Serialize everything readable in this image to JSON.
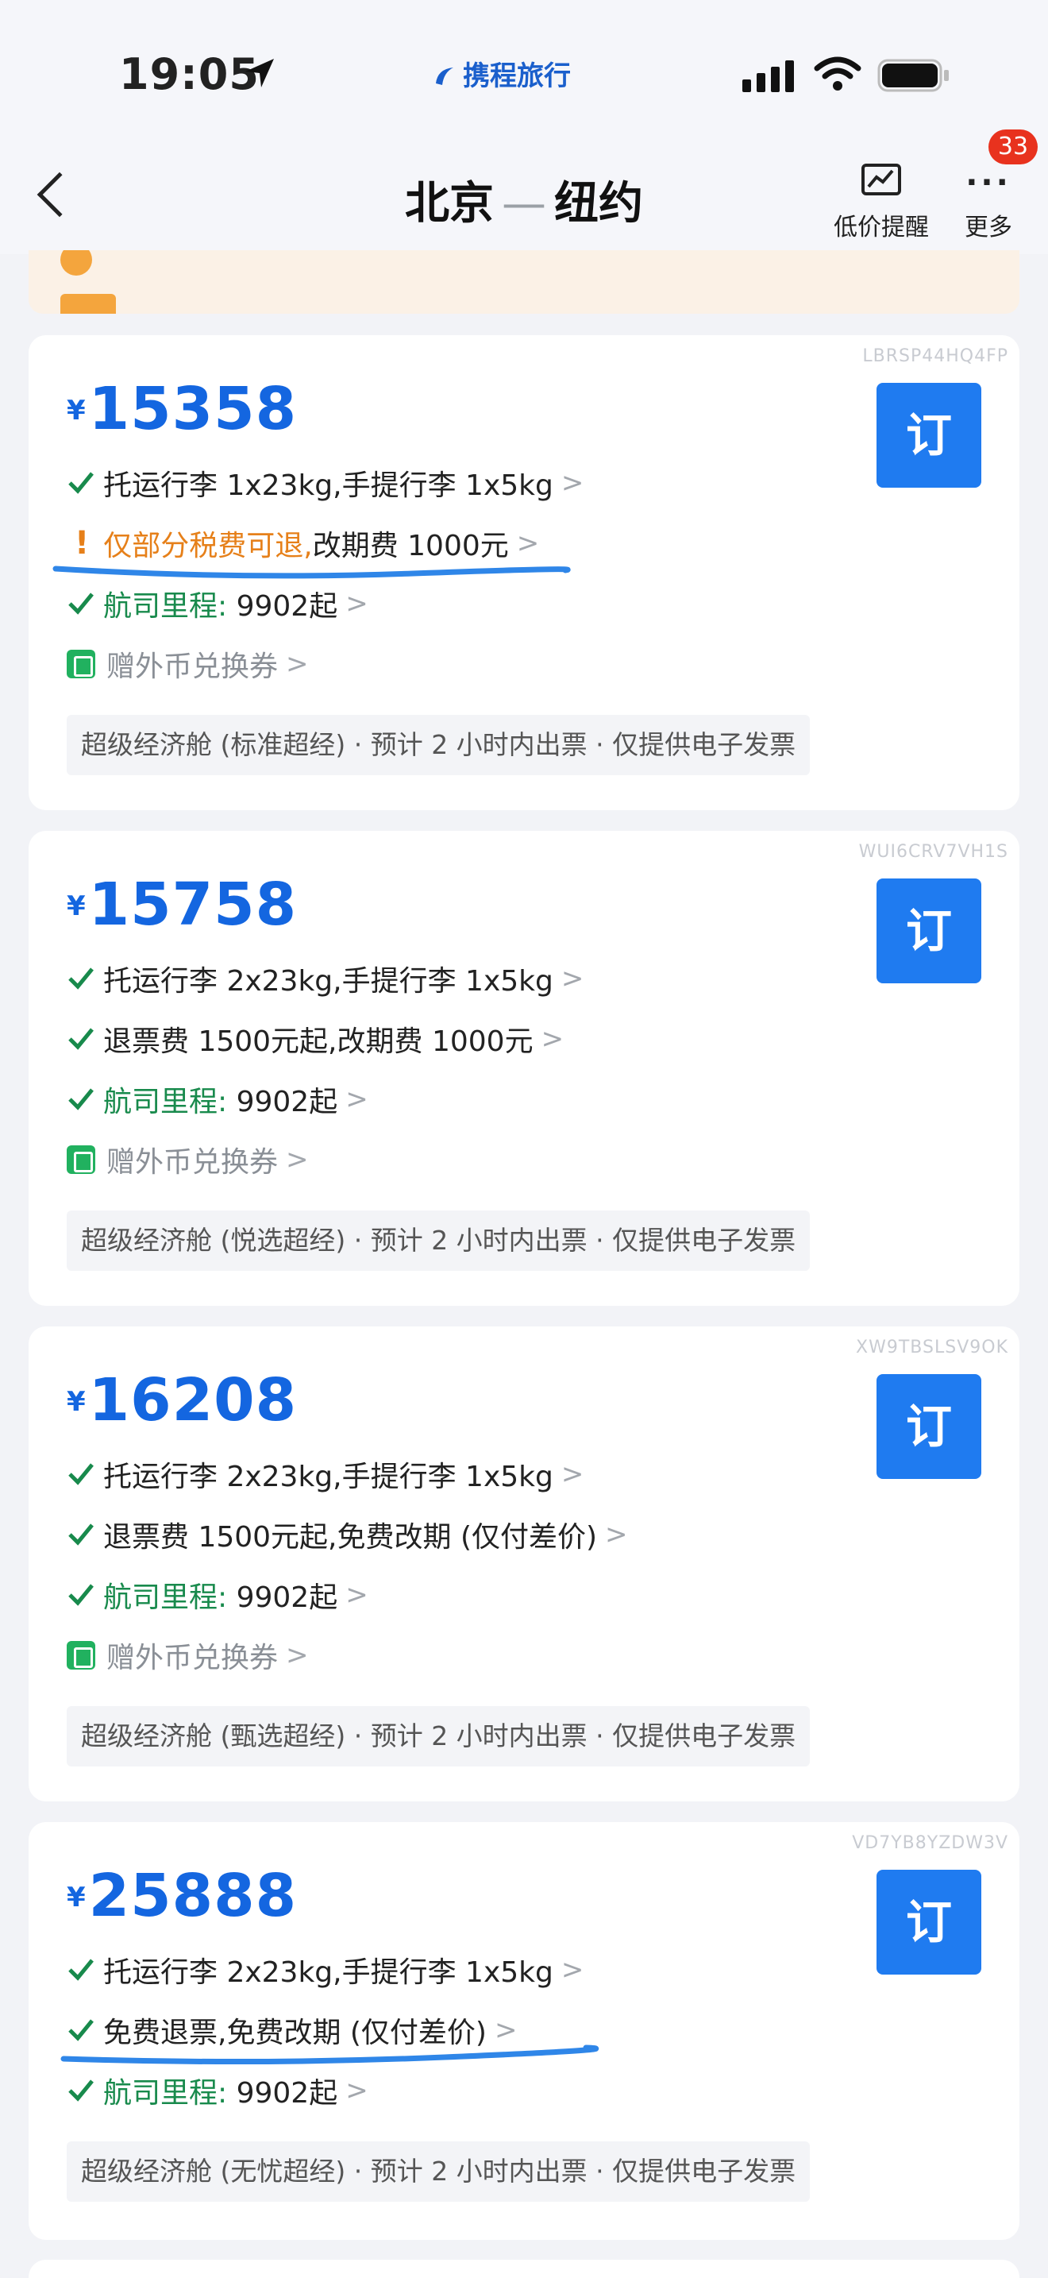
{
  "status_bar": {
    "time": "19:05",
    "app_brand": "携程旅行"
  },
  "nav": {
    "origin": "北京",
    "separator": "—",
    "destination": "纽约",
    "price_alert_label": "低价提醒",
    "more_label": "更多",
    "badge_count": "33"
  },
  "colors": {
    "price_blue": "#1466e0",
    "book_blue": "#1f7bf0",
    "green": "#188a4c",
    "orange": "#e6801a",
    "badge_red": "#e8321e"
  },
  "cards": [
    {
      "code": "LBRSP44HQ4FP",
      "currency": "¥",
      "price": "15358",
      "book_label": "订",
      "baggage": "托运行李 1x23kg,手提行李 1x5kg",
      "refund_warn": "仅部分税费可退,",
      "change_fee": "改期费 1000元",
      "miles_label": "航司里程:",
      "miles_value": "9902起",
      "coupon": "赠外币兑换券",
      "info": "超级经济舱 (标准超经) · 预计 2 小时内出票 · 仅提供电子发票"
    },
    {
      "code": "WUI6CRV7VH1S",
      "currency": "¥",
      "price": "15758",
      "book_label": "订",
      "baggage": "托运行李 2x23kg,手提行李 1x5kg",
      "refund": "退票费 1500元起,改期费 1000元",
      "miles_label": "航司里程:",
      "miles_value": "9902起",
      "coupon": "赠外币兑换券",
      "info": "超级经济舱 (悦选超经) · 预计 2 小时内出票 · 仅提供电子发票"
    },
    {
      "code": "XW9TBSLSV9OK",
      "currency": "¥",
      "price": "16208",
      "book_label": "订",
      "baggage": "托运行李 2x23kg,手提行李 1x5kg",
      "refund": "退票费 1500元起,免费改期 (仅付差价)",
      "miles_label": "航司里程:",
      "miles_value": "9902起",
      "coupon": "赠外币兑换券",
      "info": "超级经济舱 (甄选超经) · 预计 2 小时内出票 · 仅提供电子发票"
    },
    {
      "code": "VD7YB8YZDW3V",
      "currency": "¥",
      "price": "25888",
      "book_label": "订",
      "baggage": "托运行李 2x23kg,手提行李 1x5kg",
      "refund": "免费退票,免费改期 (仅付差价)",
      "miles_label": "航司里程:",
      "miles_value": "9902起",
      "info": "超级经济舱 (无忧超经) · 预计 2 小时内出票 · 仅提供电子发票"
    }
  ]
}
